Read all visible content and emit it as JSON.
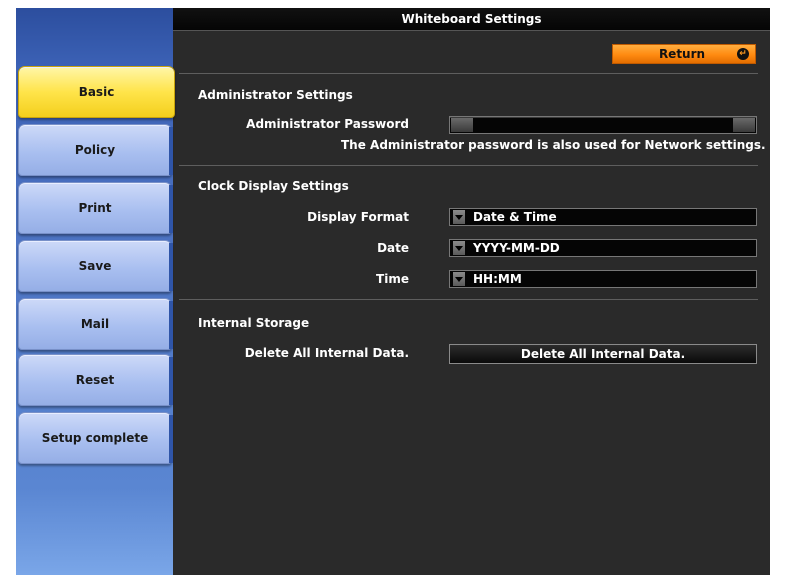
{
  "window": {
    "title": "Whiteboard Settings"
  },
  "sidebar": {
    "items": [
      {
        "label": "Basic",
        "active": true
      },
      {
        "label": "Policy"
      },
      {
        "label": "Print"
      },
      {
        "label": "Save"
      },
      {
        "label": "Mail"
      },
      {
        "label": "Reset"
      },
      {
        "label": "Setup complete"
      }
    ]
  },
  "toolbar": {
    "return_label": "Return",
    "return_icon": "enter-icon"
  },
  "admin": {
    "section_title": "Administrator Settings",
    "password_label": "Administrator Password",
    "password_value": "",
    "note": "The Administrator password is also used for Network settings."
  },
  "clock": {
    "section_title": "Clock Display Settings",
    "display_format_label": "Display Format",
    "display_format_value": "Date & Time",
    "date_label": "Date",
    "date_value": "YYYY-MM-DD",
    "time_label": "Time",
    "time_value": "HH:MM"
  },
  "storage": {
    "section_title": "Internal Storage",
    "delete_label": "Delete All Internal Data.",
    "delete_button": "Delete All Internal Data."
  },
  "colors": {
    "active_tab": "#ffe44a",
    "tab": "#a9bff0",
    "panel_bg": "#2a2a2a",
    "return_button": "#ff8a10"
  }
}
